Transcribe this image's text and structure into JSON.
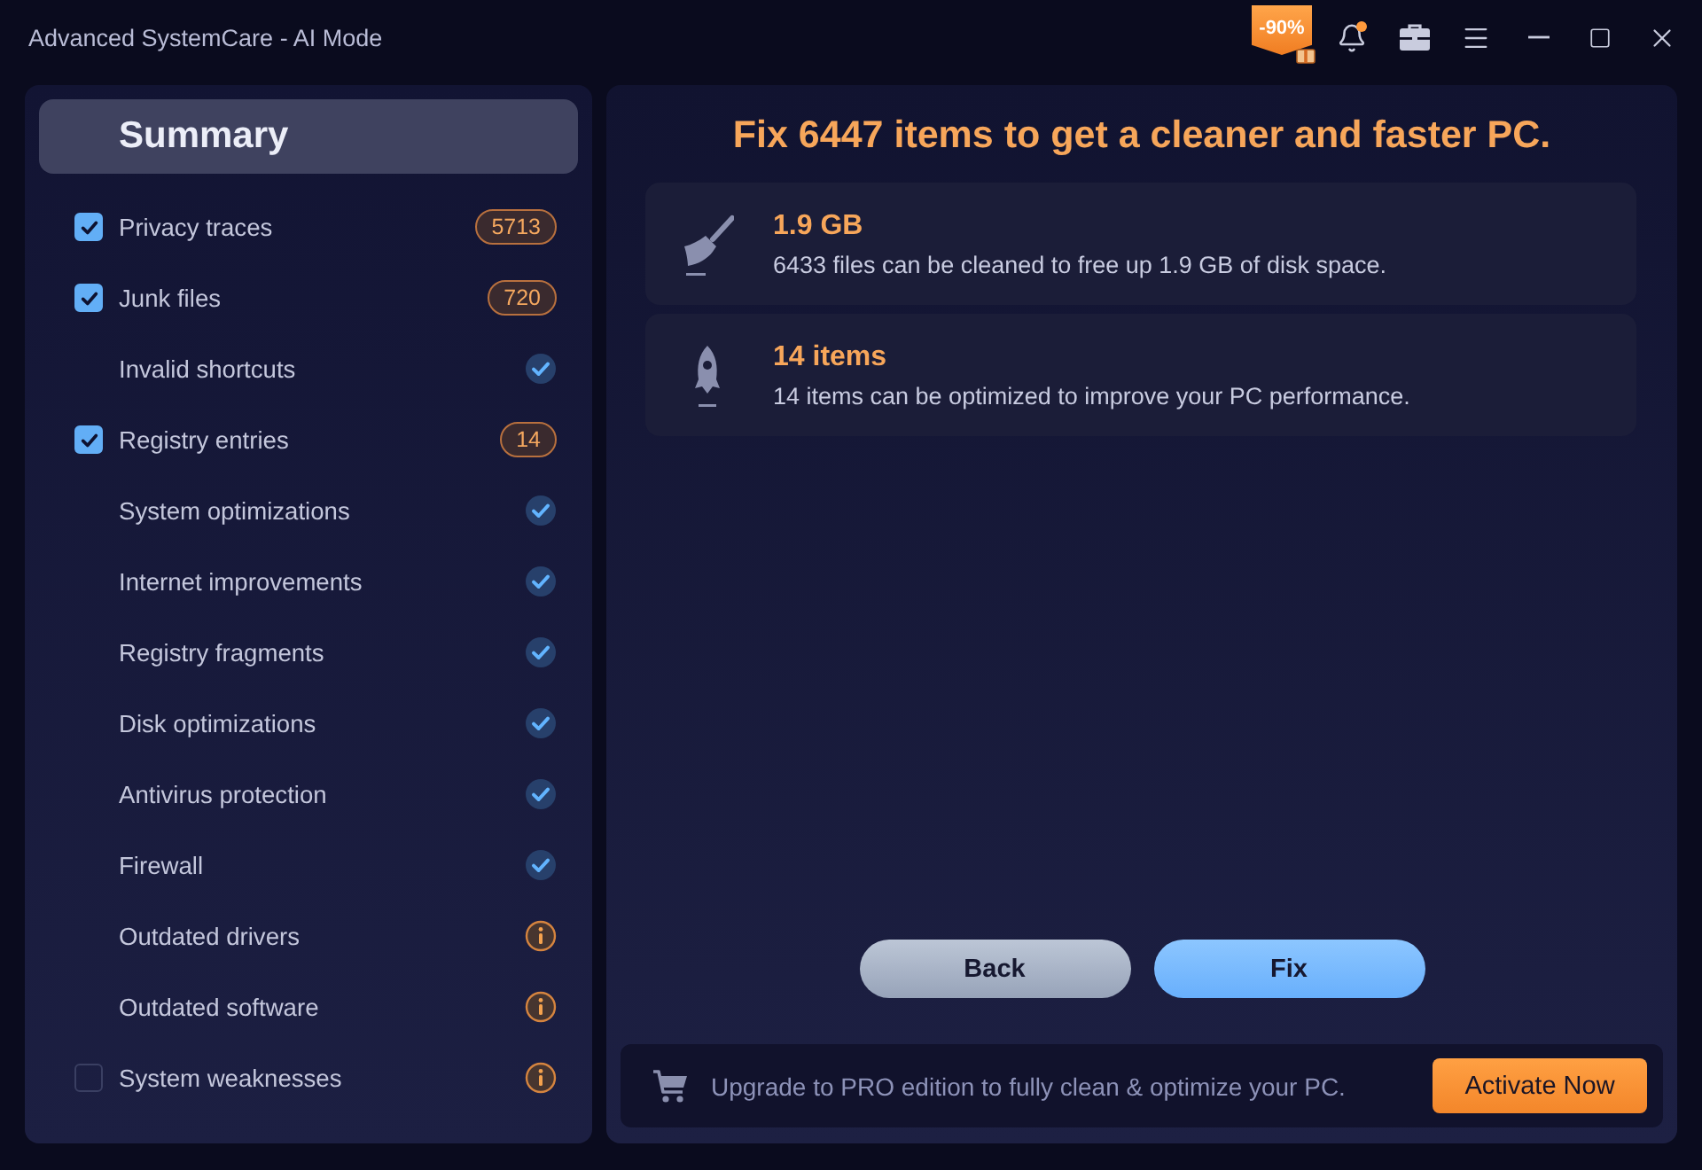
{
  "window": {
    "title": "Advanced SystemCare - AI Mode",
    "promo_badge": "-90%",
    "notification_dot": true
  },
  "sidebar": {
    "title": "Summary",
    "items": [
      {
        "label": "Privacy traces",
        "checkbox": {
          "checked": true
        },
        "kind": "count",
        "count": "5713"
      },
      {
        "label": "Junk files",
        "checkbox": {
          "checked": true
        },
        "kind": "count",
        "count": "720"
      },
      {
        "label": "Invalid shortcuts",
        "kind": "ok"
      },
      {
        "label": "Registry entries",
        "checkbox": {
          "checked": true
        },
        "kind": "count",
        "count": "14"
      },
      {
        "label": "System optimizations",
        "kind": "ok"
      },
      {
        "label": "Internet improvements",
        "kind": "ok"
      },
      {
        "label": "Registry fragments",
        "kind": "ok"
      },
      {
        "label": "Disk optimizations",
        "kind": "ok"
      },
      {
        "label": "Antivirus protection",
        "kind": "ok"
      },
      {
        "label": "Firewall",
        "kind": "ok"
      },
      {
        "label": "Outdated drivers",
        "kind": "info"
      },
      {
        "label": "Outdated software",
        "kind": "info"
      },
      {
        "label": "System weaknesses",
        "checkbox": {
          "checked": false
        },
        "kind": "info"
      }
    ]
  },
  "main": {
    "headline": "Fix 6447 items to get a cleaner and faster PC.",
    "results": [
      {
        "kind": "clean",
        "value": "1.9 GB",
        "description": "6433 files can be cleaned to free up 1.9 GB of disk space."
      },
      {
        "kind": "optimize",
        "value": "14 items",
        "description": "14 items can be optimized to improve your PC performance."
      }
    ],
    "buttons": [
      {
        "kind": "secondary",
        "label": "Back"
      },
      {
        "kind": "primary",
        "label": "Fix"
      }
    ],
    "upgrade_bar": {
      "message": "Upgrade to PRO edition to fully clean & optimize your PC.",
      "button": "Activate Now"
    }
  }
}
